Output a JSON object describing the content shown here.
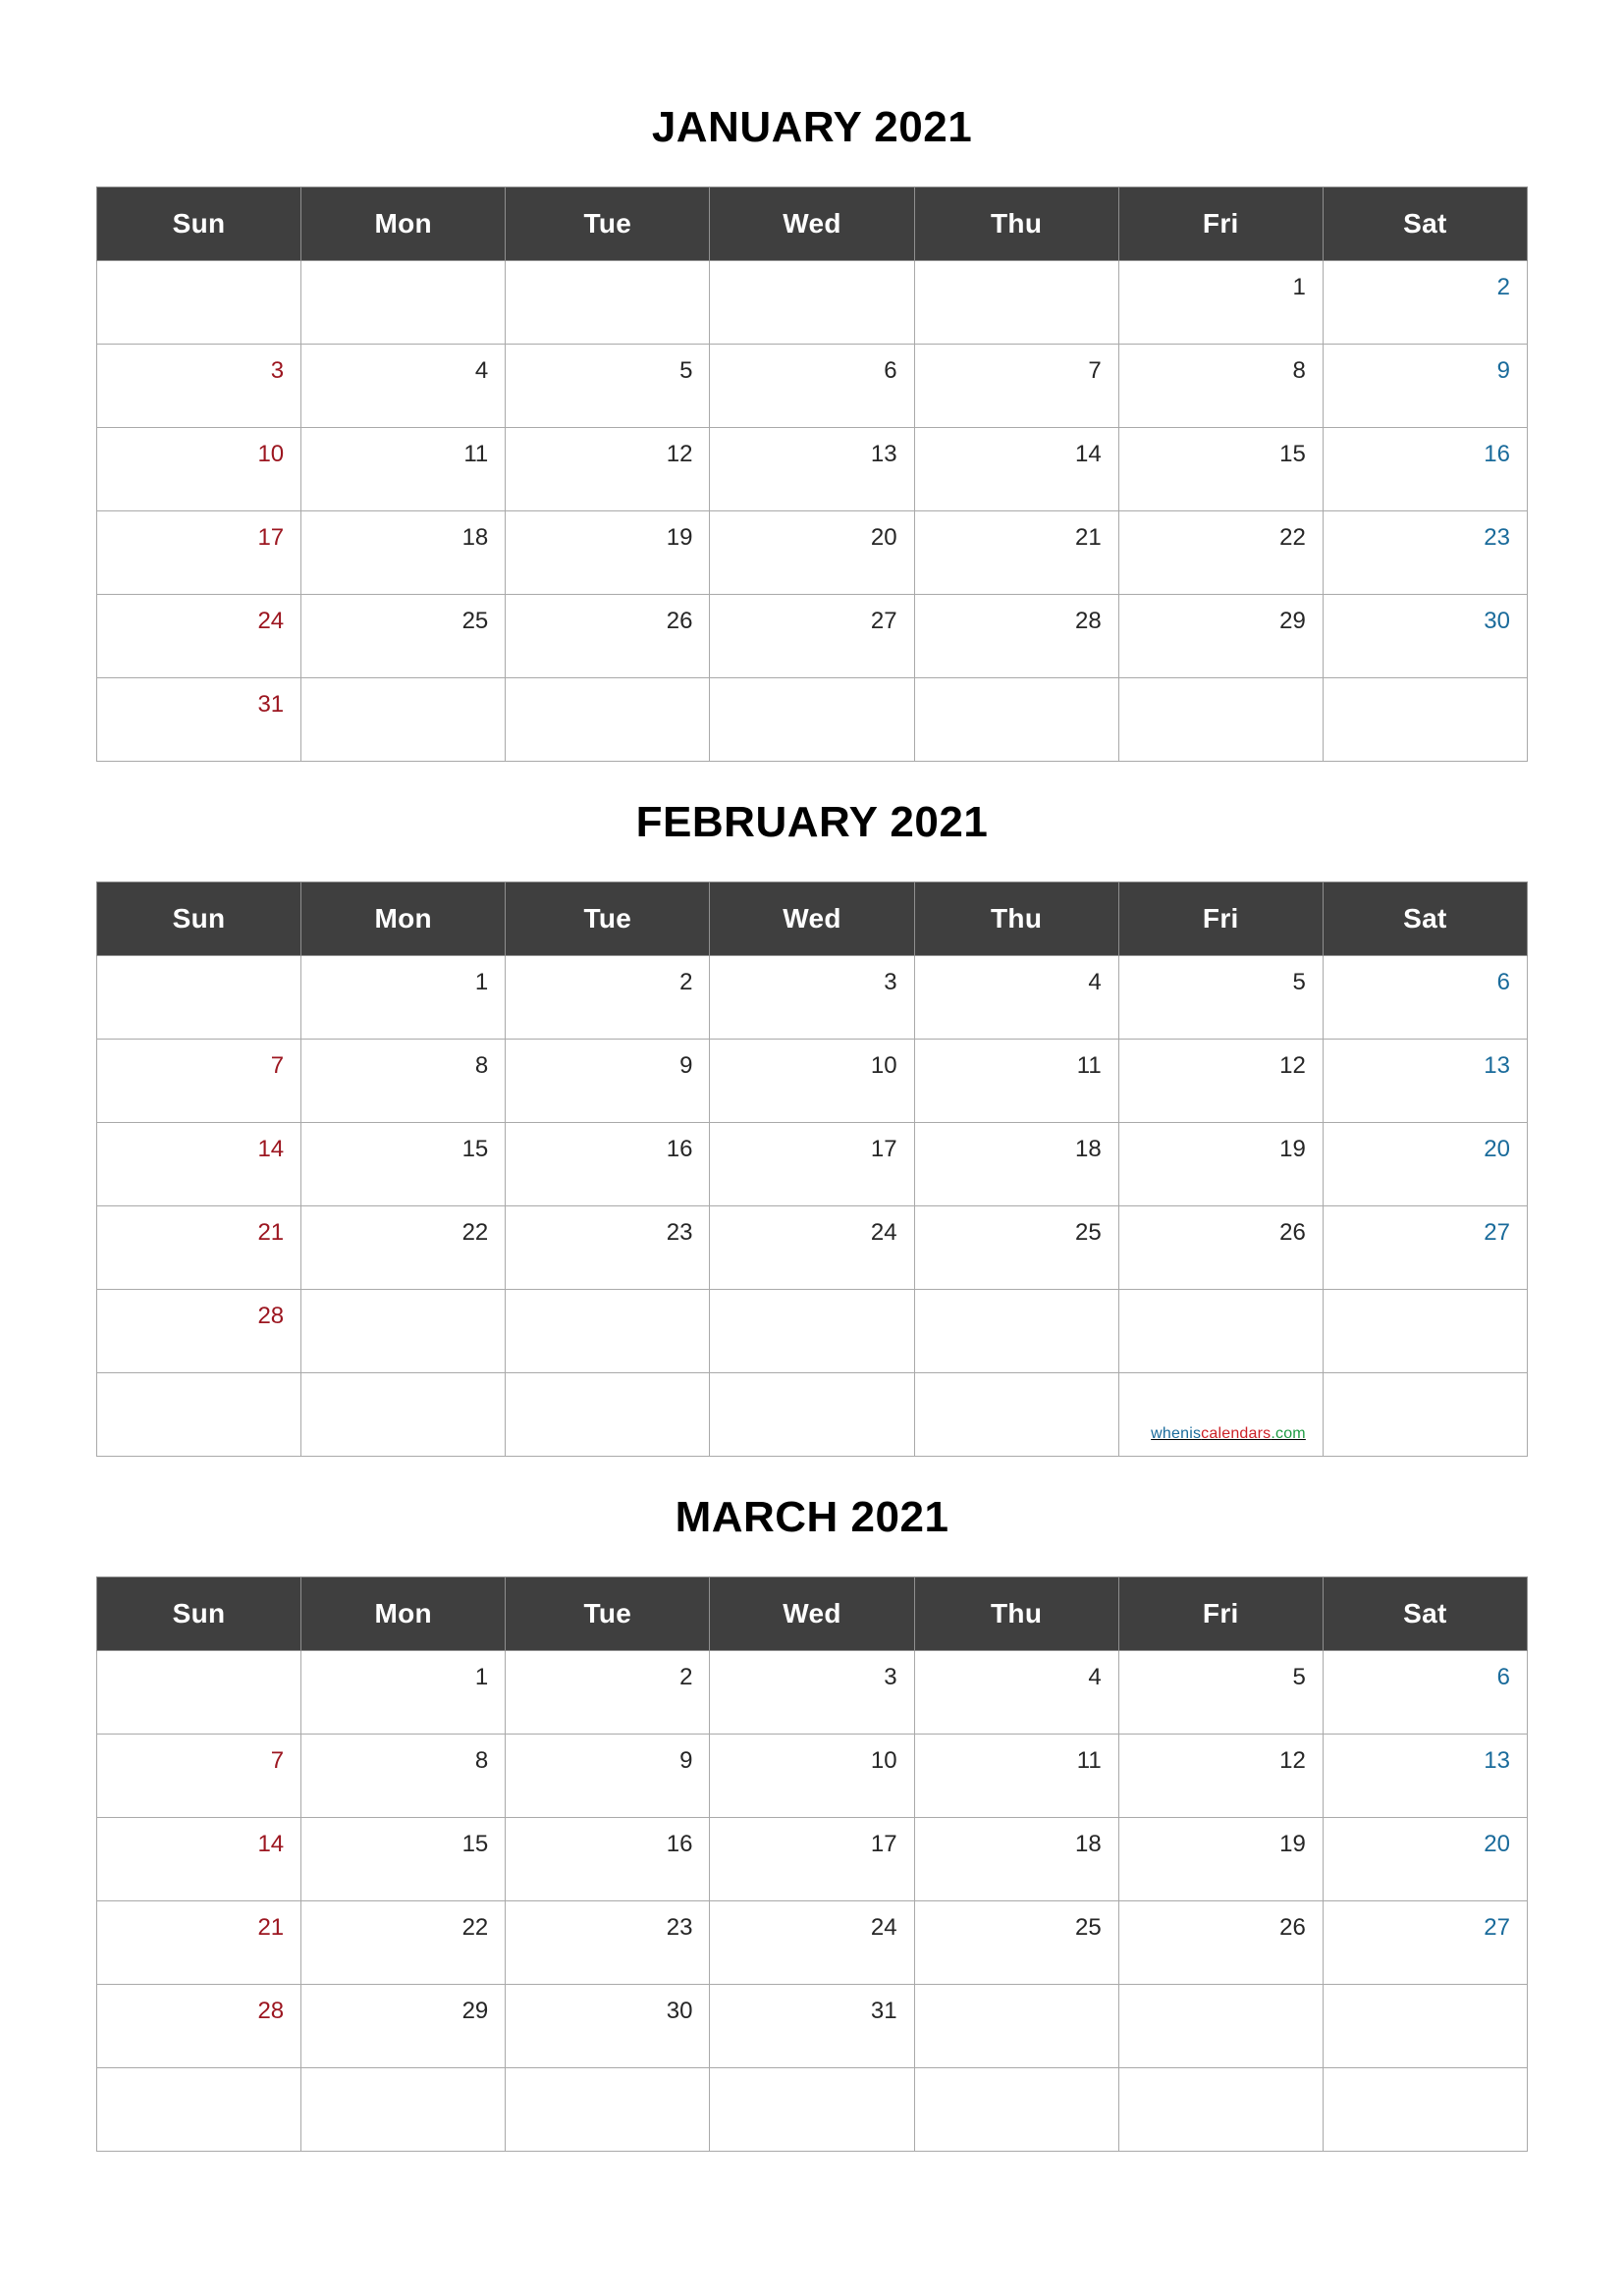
{
  "page": {
    "background": "#ffffff",
    "header_bg": "#3f3f3f",
    "header_fg": "#ffffff",
    "grid_line": "#a9a9a9",
    "weekday_color": "#262626",
    "sunday_color": "#9c1620",
    "saturday_color": "#1a6b9b"
  },
  "weekdays": [
    "Sun",
    "Mon",
    "Tue",
    "Wed",
    "Thu",
    "Fri",
    "Sat"
  ],
  "watermark": {
    "part1": "whenis",
    "part2": "calendars",
    "part3": ".com",
    "part1_color": "#1a6b9b",
    "part2_color": "#cc2127",
    "part3_color": "#1e9c43"
  },
  "months": [
    {
      "title": "JANUARY 2021",
      "weeks": [
        [
          "",
          "",
          "",
          "",
          "",
          "1",
          "2"
        ],
        [
          "3",
          "4",
          "5",
          "6",
          "7",
          "8",
          "9"
        ],
        [
          "10",
          "11",
          "12",
          "13",
          "14",
          "15",
          "16"
        ],
        [
          "17",
          "18",
          "19",
          "20",
          "21",
          "22",
          "23"
        ],
        [
          "24",
          "25",
          "26",
          "27",
          "28",
          "29",
          "30"
        ],
        [
          "31",
          "",
          "",
          "",
          "",
          "",
          ""
        ]
      ]
    },
    {
      "title": "FEBRUARY 2021",
      "weeks": [
        [
          "",
          "1",
          "2",
          "3",
          "4",
          "5",
          "6"
        ],
        [
          "7",
          "8",
          "9",
          "10",
          "11",
          "12",
          "13"
        ],
        [
          "14",
          "15",
          "16",
          "17",
          "18",
          "19",
          "20"
        ],
        [
          "21",
          "22",
          "23",
          "24",
          "25",
          "26",
          "27"
        ],
        [
          "28",
          "",
          "",
          "",
          "",
          "",
          ""
        ],
        [
          "",
          "",
          "",
          "",
          "",
          "",
          ""
        ]
      ]
    },
    {
      "title": "MARCH 2021",
      "weeks": [
        [
          "",
          "1",
          "2",
          "3",
          "4",
          "5",
          "6"
        ],
        [
          "7",
          "8",
          "9",
          "10",
          "11",
          "12",
          "13"
        ],
        [
          "14",
          "15",
          "16",
          "17",
          "18",
          "19",
          "20"
        ],
        [
          "21",
          "22",
          "23",
          "24",
          "25",
          "26",
          "27"
        ],
        [
          "28",
          "29",
          "30",
          "31",
          "",
          "",
          ""
        ],
        [
          "",
          "",
          "",
          "",
          "",
          "",
          ""
        ]
      ]
    }
  ]
}
